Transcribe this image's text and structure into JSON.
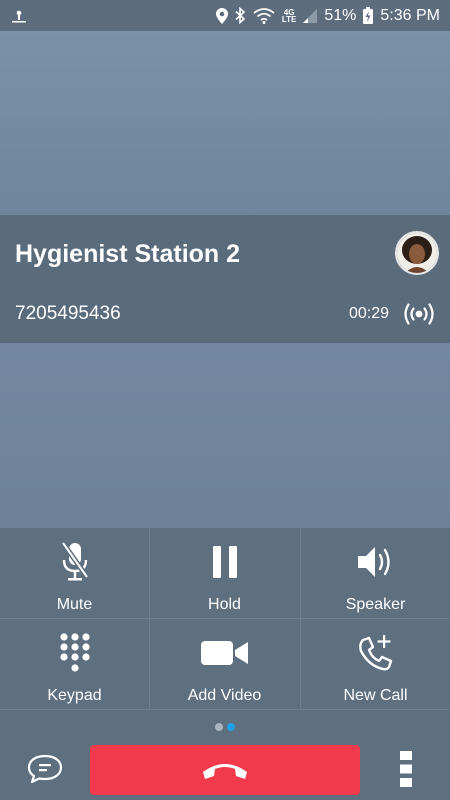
{
  "status_bar": {
    "battery": "51%",
    "time": "5:36 PM",
    "network": "4G",
    "network_sub": "LTE"
  },
  "call": {
    "name": "Hygienist Station 2",
    "number": "7205495436",
    "timer": "00:29"
  },
  "controls": [
    {
      "label": "Mute",
      "icon": "microphone-off-icon"
    },
    {
      "label": "Hold",
      "icon": "pause-icon"
    },
    {
      "label": "Speaker",
      "icon": "speaker-icon"
    },
    {
      "label": "Keypad",
      "icon": "keypad-icon"
    },
    {
      "label": "Add Video",
      "icon": "video-camera-icon"
    },
    {
      "label": "New Call",
      "icon": "phone-plus-icon"
    }
  ],
  "pager": {
    "page": 2,
    "pages": 2
  },
  "colors": {
    "end_call": "#f23a4d",
    "active_dot": "#1ea0e6",
    "inactive_dot": "#aab4be"
  }
}
